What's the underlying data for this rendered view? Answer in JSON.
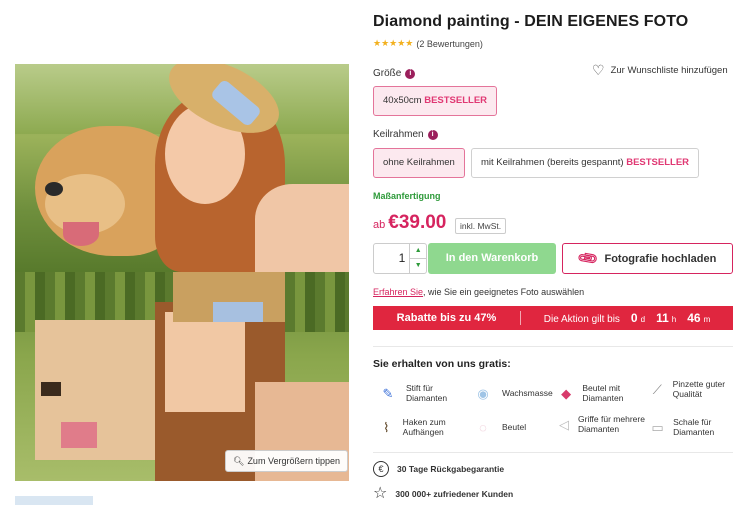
{
  "product": {
    "title": "Diamond painting - DEIN EIGENES FOTO",
    "stars": "★★★★★",
    "reviews": "(2 Bewertungen)"
  },
  "image": {
    "zoom_label": "Zum Vergrößern tippen"
  },
  "wishlist": {
    "label": "Zur Wunschliste hinzufügen"
  },
  "size": {
    "label": "Größe",
    "option": "40x50cm",
    "badge": "BESTSELLER"
  },
  "frame": {
    "label": "Keilrahmen",
    "option1": "ohne Keilrahmen",
    "option2": "mit Keilrahmen (bereits gespannt)",
    "option2_badge": "BESTSELLER"
  },
  "custom_label": "Maßanfertigung",
  "price": {
    "prefix": "ab",
    "amount": "€39.00",
    "vat": "inkl. MwSt."
  },
  "cart": {
    "quantity": "1",
    "add_label": "In den Warenkorb",
    "upload_label": "Fotografie hochladen"
  },
  "learn": {
    "link": "Erfahren Sie",
    "text": ", wie Sie ein geeignetes Foto auswählen"
  },
  "promo": {
    "discount": "Rabatte bis zu 47%",
    "valid": "Die Aktion gilt bis",
    "days": "0",
    "days_unit": "d",
    "hours": "11",
    "hours_unit": "h",
    "minutes": "46",
    "minutes_unit": "m"
  },
  "gifts": {
    "title": "Sie erhalten von uns gratis:",
    "items": [
      "Stift für Diamanten",
      "Wachsmasse",
      "Beutel mit Diamanten",
      "Pinzette guter Qualität",
      "Haken zum Aufhängen",
      "Beutel",
      "Griffe für mehrere Diamanten",
      "Schale für Diamanten"
    ]
  },
  "benefits": {
    "return": "30 Tage Rückgabegarantie",
    "customers": "300 000+ zufriedener Kunden"
  },
  "colors": {
    "accent": "#d6245f",
    "cart": "#8fd88f",
    "promo": "#e0263f",
    "star": "#f2b01e"
  }
}
